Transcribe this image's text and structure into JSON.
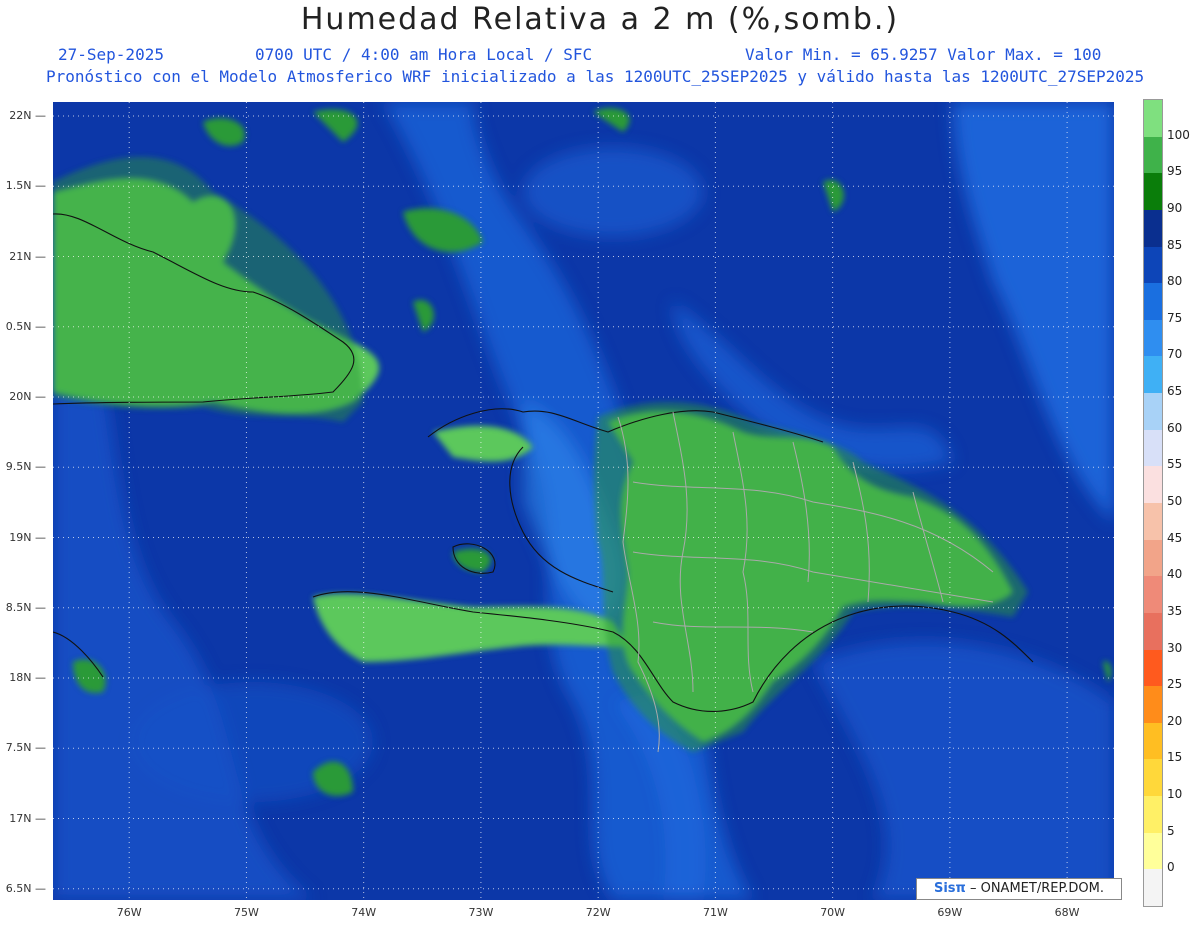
{
  "header": {
    "title": "Humedad Relativa a 2 m (%,somb.)",
    "date": "27-Sep-2025",
    "time": "0700 UTC / 4:00 am Hora Local / SFC",
    "minmax": "Valor Min. = 65.9257  Valor Max. = 100",
    "description": "Pronóstico con el Modelo Atmosferico WRF inicializado a las 1200UTC_25SEP2025 y válido hasta las  1200UTC_27SEP2025"
  },
  "axes": {
    "lat_labels": [
      "22N",
      "1.5N",
      "21N",
      "0.5N",
      "20N",
      "9.5N",
      "19N",
      "8.5N",
      "18N",
      "7.5N",
      "17N",
      "6.5N"
    ],
    "lat_values": [
      22,
      21.5,
      21,
      20.5,
      20,
      19.5,
      19,
      18.5,
      18,
      17.5,
      17,
      16.5
    ],
    "lon_labels": [
      "76W",
      "75W",
      "74W",
      "73W",
      "72W",
      "71W",
      "70W",
      "69W",
      "68W"
    ],
    "lon_values": [
      -76,
      -75,
      -74,
      -73,
      -72,
      -71,
      -70,
      -69,
      -68
    ],
    "lat_range": [
      16.42,
      22.1
    ],
    "lon_range": [
      -76.65,
      -67.6
    ]
  },
  "legend": {
    "labels": [
      "100",
      "95",
      "90",
      "85",
      "80",
      "75",
      "70",
      "65",
      "60",
      "55",
      "50",
      "45",
      "40",
      "35",
      "30",
      "25",
      "20",
      "15",
      "10",
      "5",
      "0"
    ],
    "colors": [
      "#7fe07f",
      "#3fb24a",
      "#0a7d0a",
      "#0a2f8f",
      "#0d45b8",
      "#1a6fe0",
      "#2f8ef0",
      "#3fb0f5",
      "#a8d2f7",
      "#d8e0f8",
      "#fbe0e0",
      "#f7c2aa",
      "#f2a489",
      "#ef8a78",
      "#e8705e",
      "#ff5a1e",
      "#ff8c1a",
      "#ffbe22",
      "#ffd83a",
      "#fff066",
      "#ffff9a",
      "#f4f4f4"
    ]
  },
  "credit": {
    "logo": "Sisπ",
    "text": "– ONAMET/REP.DOM."
  },
  "colors": {
    "ocean_deep": "#0c37a8",
    "ocean_mid": "#1552c8",
    "ocean_light": "#1f6be0",
    "land": "#5cc85c",
    "land_dark": "#2a9a38",
    "coast": "#111111",
    "borders": "#aaaaaa"
  }
}
